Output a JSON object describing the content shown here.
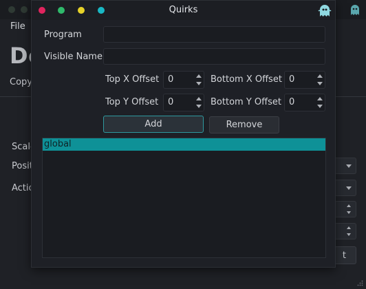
{
  "background_window": {
    "menu_file": "File",
    "title_partial": "De",
    "copy_partial": "Copy",
    "label_scale": "Scale",
    "label_position": "Posit",
    "label_action": "Actio",
    "button_tail": "t"
  },
  "dialog": {
    "title": "Quirks",
    "program_label": "Program",
    "program_value": "",
    "visible_name_label": "Visible Name",
    "visible_name_value": "",
    "top_x_label": "Top X Offset",
    "top_x_value": "0",
    "bottom_x_label": "Bottom X Offset",
    "bottom_x_value": "0",
    "top_y_label": "Top Y Offset",
    "top_y_value": "0",
    "bottom_y_label": "Bottom Y Offset",
    "bottom_y_value": "0",
    "add_label": "Add",
    "remove_label": "Remove",
    "list_items": [
      "global"
    ]
  },
  "colors": {
    "close_dot": "#e0245e",
    "min_dot": "#2fba6b",
    "max_dot": "#e6d229",
    "extra_dot": "#19b8c4",
    "selection": "#0e9197",
    "accent_border": "#2e9aa0",
    "ghost_icon": "#8fd8e0"
  },
  "icons": {
    "app_icon": "ghost-icon",
    "resize": "resize-grip-icon"
  }
}
